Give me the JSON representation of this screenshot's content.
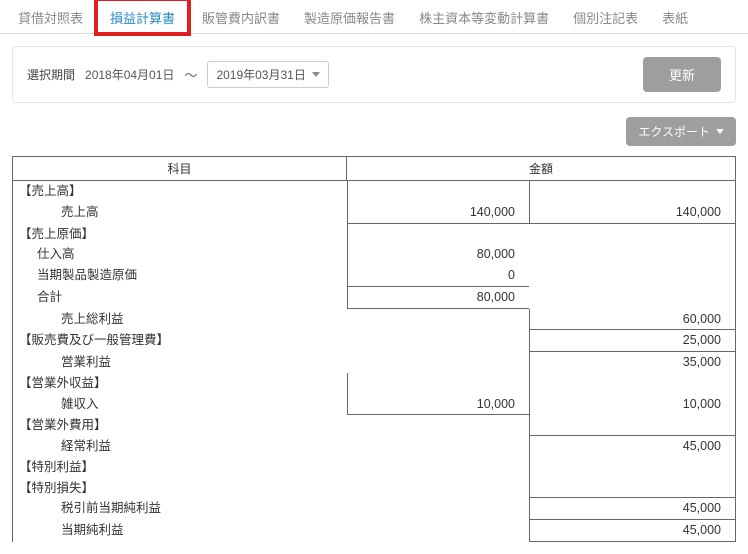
{
  "tabs": [
    {
      "label": "貸借対照表",
      "active": false
    },
    {
      "label": "損益計算書",
      "active": true,
      "highlight": true
    },
    {
      "label": "販管費内訳書",
      "active": false
    },
    {
      "label": "製造原価報告書",
      "active": false
    },
    {
      "label": "株主資本等変動計算書",
      "active": false
    },
    {
      "label": "個別注記表",
      "active": false
    },
    {
      "label": "表紙",
      "active": false
    }
  ],
  "filter": {
    "label": "選択期間",
    "start_text": "2018年04月01日",
    "tilde": "～",
    "end_text": "2019年03月31日",
    "update_label": "更新"
  },
  "export_label": "エクスポート",
  "table": {
    "header_subject": "科目",
    "header_amount": "金額",
    "rows": [
      {
        "label": "【売上高】",
        "indent": 0,
        "mid": "",
        "right": "",
        "subject_br": false,
        "mid_bl": true,
        "mid_bb": false,
        "right_bl": true,
        "right_bb": false
      },
      {
        "label": "売上高",
        "indent": 2,
        "mid": "140,000",
        "right": "140,000",
        "subject_br": false,
        "mid_bl": true,
        "mid_bb": true,
        "right_bl": true,
        "right_bb": true
      },
      {
        "label": "【売上原価】",
        "indent": 0,
        "mid": "",
        "right": "",
        "subject_br": false,
        "mid_bl": true,
        "mid_bb": false,
        "right_bl": false,
        "right_bb": false
      },
      {
        "label": "仕入高",
        "indent": 1,
        "mid": "80,000",
        "right": "",
        "subject_br": false,
        "mid_bl": true,
        "mid_bb": false,
        "right_bl": false,
        "right_bb": false
      },
      {
        "label": "当期製品製造原価",
        "indent": 1,
        "mid": "0",
        "right": "",
        "subject_br": false,
        "mid_bl": true,
        "mid_bb": true,
        "right_bl": false,
        "right_bb": false
      },
      {
        "label": "合計",
        "indent": 1,
        "mid": "80,000",
        "right": "",
        "subject_br": false,
        "mid_bl": true,
        "mid_bb": true,
        "right_bl": false,
        "right_bb": false
      },
      {
        "label": "売上総利益",
        "indent": 2,
        "mid": "",
        "right": "60,000",
        "subject_br": false,
        "mid_bl": false,
        "mid_bb": false,
        "right_bl": true,
        "right_bb": true
      },
      {
        "label": "【販売費及び一般管理費】",
        "indent": 0,
        "mid": "",
        "right": "25,000",
        "subject_br": false,
        "mid_bl": false,
        "mid_bb": false,
        "right_bl": true,
        "right_bb": true
      },
      {
        "label": "営業利益",
        "indent": 2,
        "mid": "",
        "right": "35,000",
        "subject_br": false,
        "mid_bl": false,
        "mid_bb": false,
        "right_bl": true,
        "right_bb": false
      },
      {
        "label": "【営業外収益】",
        "indent": 0,
        "mid": "",
        "right": "",
        "subject_br": false,
        "mid_bl": true,
        "mid_bb": false,
        "right_bl": true,
        "right_bb": false
      },
      {
        "label": "雑収入",
        "indent": 2,
        "mid": "10,000",
        "right": "10,000",
        "subject_br": false,
        "mid_bl": true,
        "mid_bb": true,
        "right_bl": true,
        "right_bb": false
      },
      {
        "label": "【営業外費用】",
        "indent": 0,
        "mid": "",
        "right": "",
        "subject_br": false,
        "mid_bl": false,
        "mid_bb": false,
        "right_bl": true,
        "right_bb": true
      },
      {
        "label": "経常利益",
        "indent": 2,
        "mid": "",
        "right": "45,000",
        "subject_br": false,
        "mid_bl": false,
        "mid_bb": false,
        "right_bl": true,
        "right_bb": false
      },
      {
        "label": "【特別利益】",
        "indent": 0,
        "mid": "",
        "right": "",
        "subject_br": false,
        "mid_bl": false,
        "mid_bb": false,
        "right_bl": true,
        "right_bb": false
      },
      {
        "label": "【特別損失】",
        "indent": 0,
        "mid": "",
        "right": "",
        "subject_br": false,
        "mid_bl": false,
        "mid_bb": false,
        "right_bl": true,
        "right_bb": true
      },
      {
        "label": "税引前当期純利益",
        "indent": 2,
        "mid": "",
        "right": "45,000",
        "subject_br": false,
        "mid_bl": false,
        "mid_bb": false,
        "right_bl": true,
        "right_bb": true
      },
      {
        "label": "当期純利益",
        "indent": 2,
        "mid": "",
        "right": "45,000",
        "subject_br": false,
        "mid_bl": false,
        "mid_bb": false,
        "right_bl": true,
        "right_bb": true
      }
    ]
  }
}
